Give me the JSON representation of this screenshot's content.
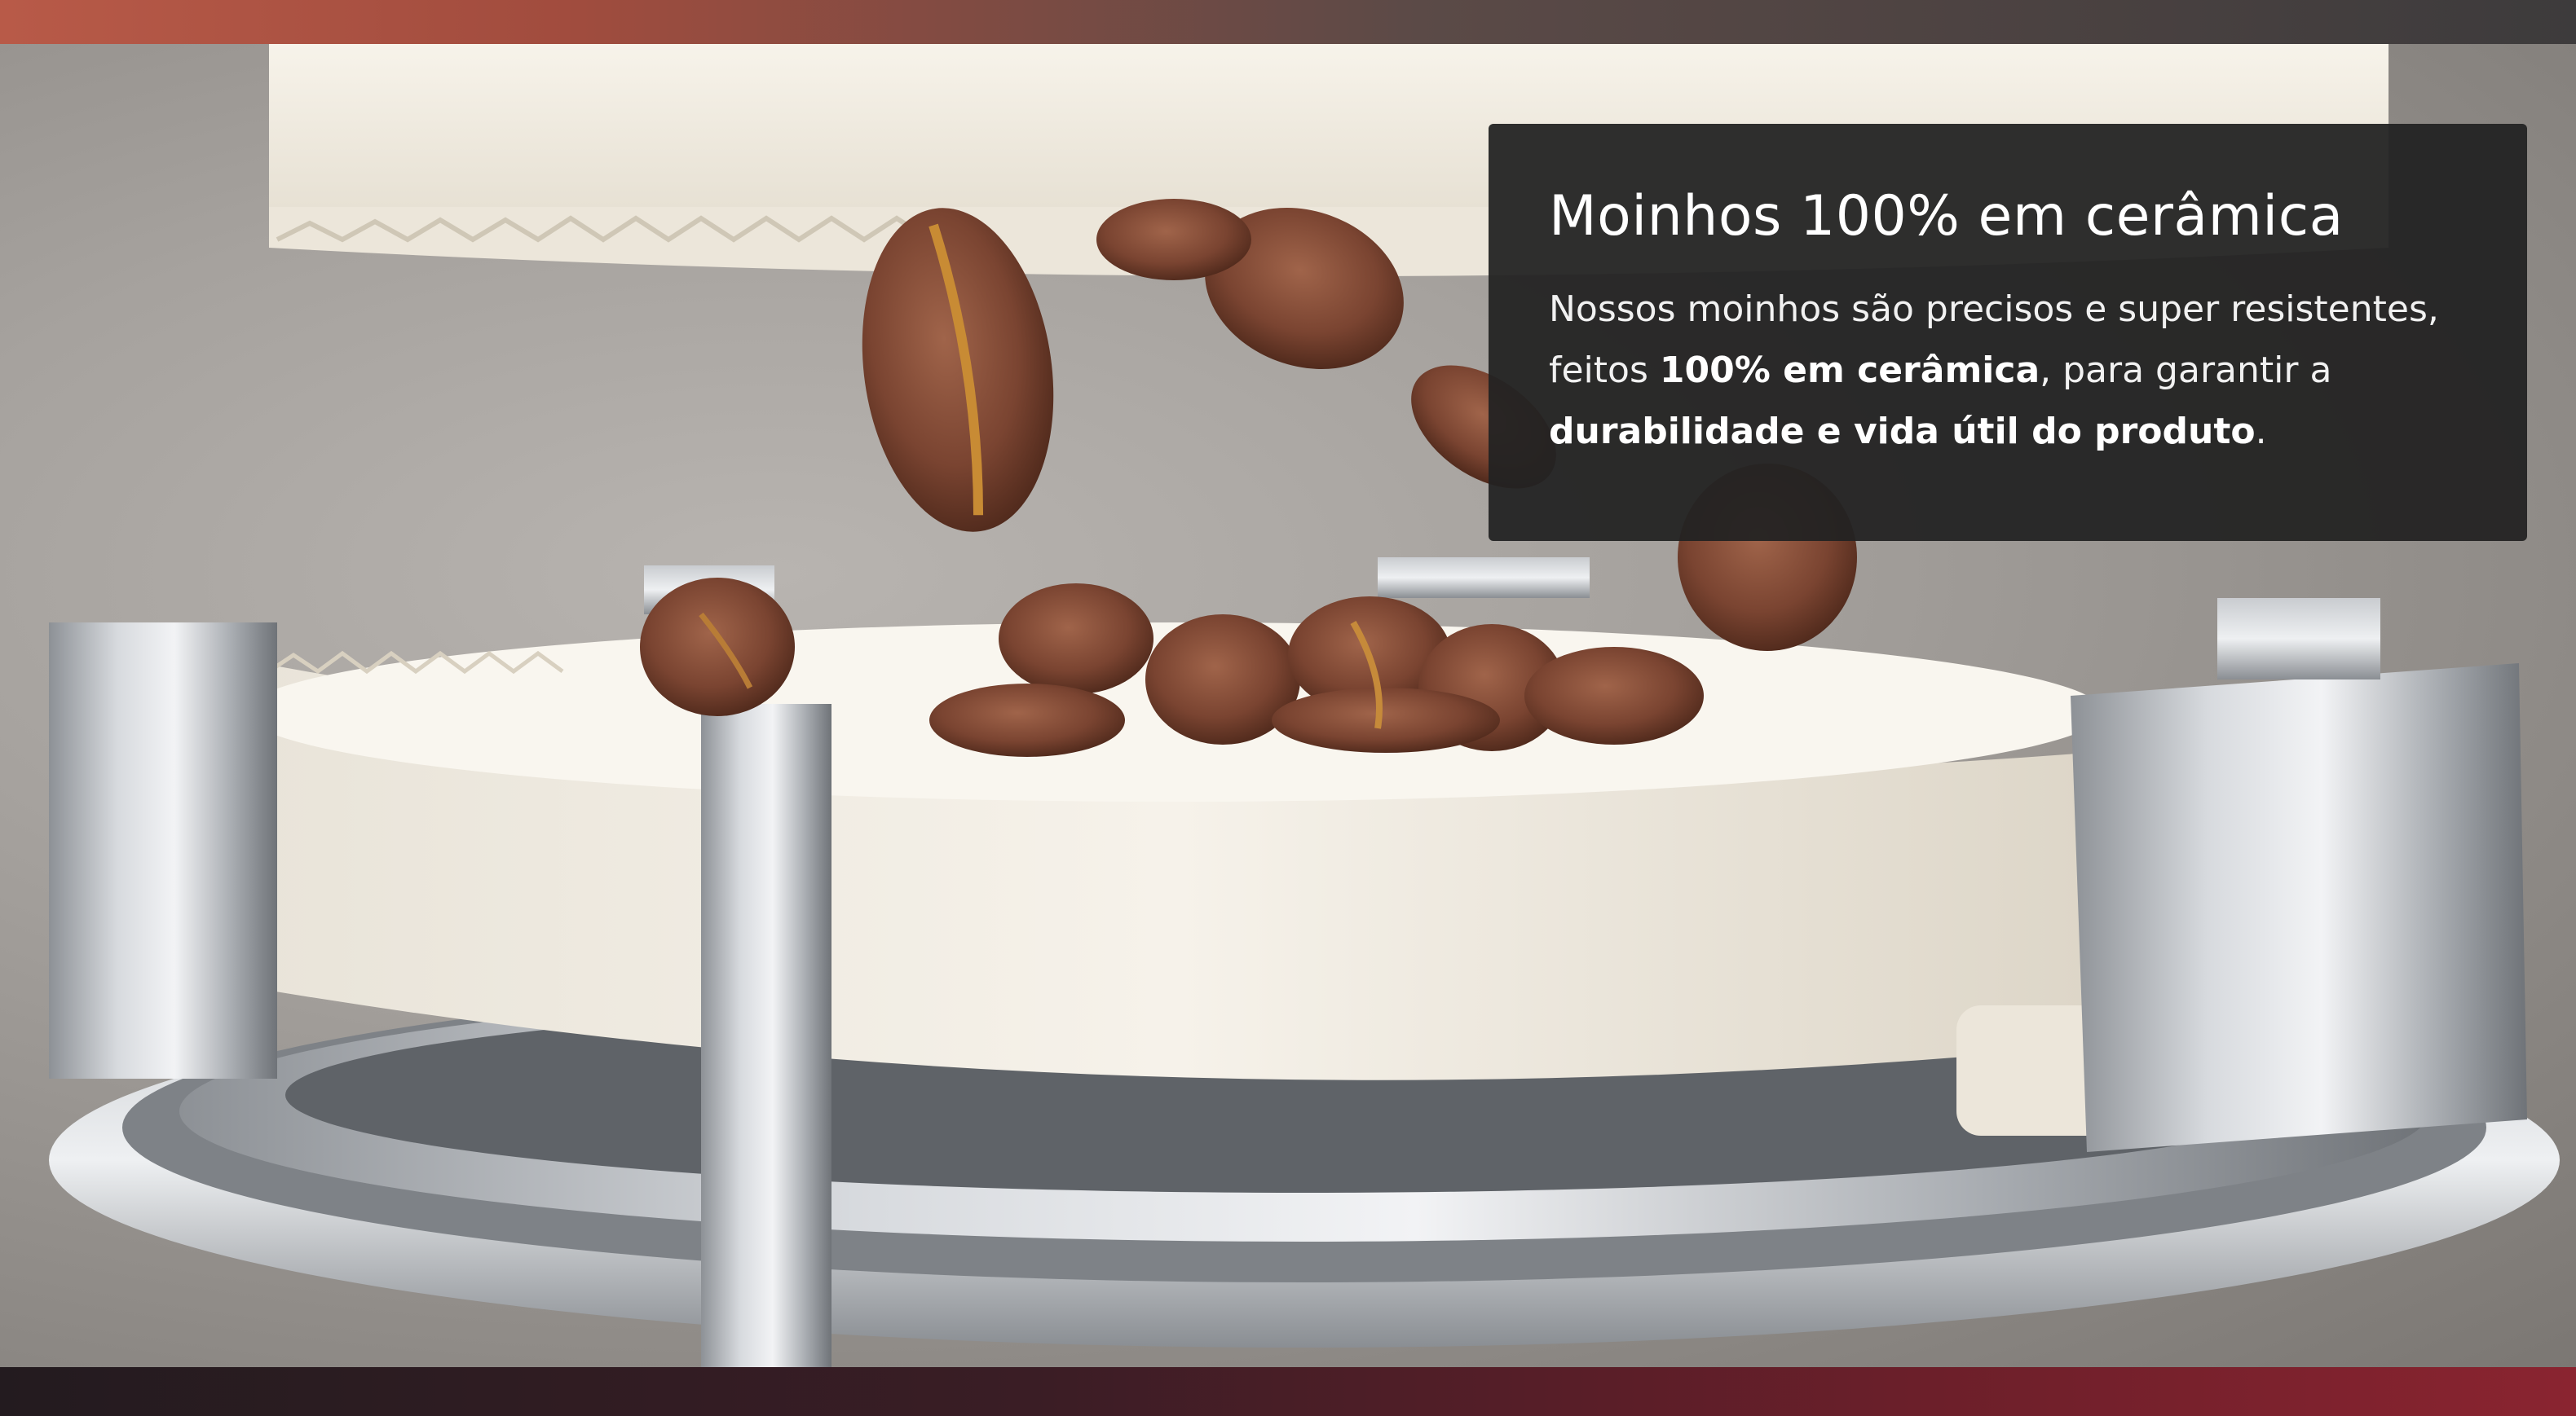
{
  "card": {
    "title": "Moinhos 100% em cerâmica",
    "body_part1": "Nossos moinhos são precisos e super resistentes, feitos ",
    "body_bold1": "100% em cerâmica",
    "body_part2": ", para garantir a ",
    "body_bold2": "durabilidade e vida útil do produto",
    "body_part3": "."
  },
  "image": {
    "icon": "ceramic-grinder-with-coffee-beans-photo"
  },
  "colors": {
    "card_background": "#222222",
    "card_text": "#ffffff",
    "top_strip": "#b85a48",
    "bottom_strip": "#8a2430"
  }
}
